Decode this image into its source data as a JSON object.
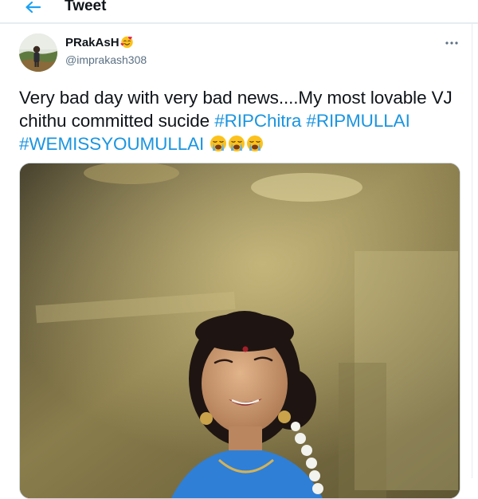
{
  "header": {
    "title": "Tweet",
    "back_icon": "arrow-left-icon"
  },
  "tweet": {
    "author": {
      "display_name": "PRakAsH",
      "name_emoji": "smiling-face-with-hearts",
      "handle": "@imprakash308"
    },
    "more_icon": "more-horizontal-icon",
    "text_prefix": "Very bad day with very bad news....My most lovable VJ chithu committed sucide ",
    "hashtags": [
      "#RIPChitra",
      "#RIPMULLAI",
      "#WEMISSYOUMULLAI"
    ],
    "emoji_count": 3,
    "emoji_name": "loudly-crying-face",
    "media_type": "photo"
  },
  "colors": {
    "link": "#1b95e0",
    "text": "#0f1419",
    "secondary": "#5b7083",
    "border": "#e6ecf0"
  }
}
